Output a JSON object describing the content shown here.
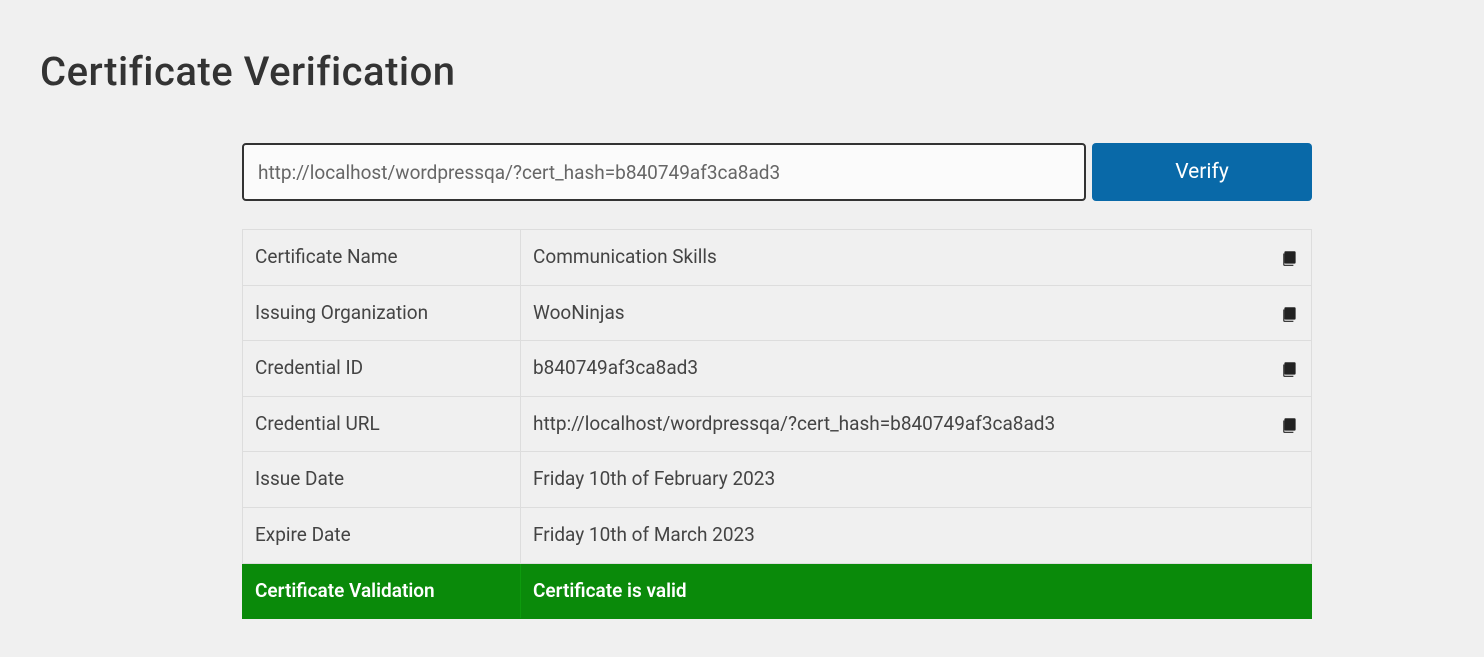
{
  "header": {
    "title": "Certificate Verification"
  },
  "search": {
    "value": "http://localhost/wordpressqa/?cert_hash=b840749af3ca8ad3",
    "verify_label": "Verify"
  },
  "table": {
    "rows": [
      {
        "label": "Certificate Name",
        "value": "Communication Skills",
        "copyable": true
      },
      {
        "label": "Issuing Organization",
        "value": "WooNinjas",
        "copyable": true
      },
      {
        "label": "Credential ID",
        "value": "b840749af3ca8ad3",
        "copyable": true
      },
      {
        "label": "Credential URL",
        "value": "http://localhost/wordpressqa/?cert_hash=b840749af3ca8ad3",
        "copyable": true
      },
      {
        "label": "Issue Date",
        "value": "Friday 10th of February 2023",
        "copyable": false
      },
      {
        "label": "Expire Date",
        "value": "Friday 10th of March 2023",
        "copyable": false
      }
    ],
    "validation": {
      "label": "Certificate Validation",
      "value": "Certificate is valid"
    }
  }
}
